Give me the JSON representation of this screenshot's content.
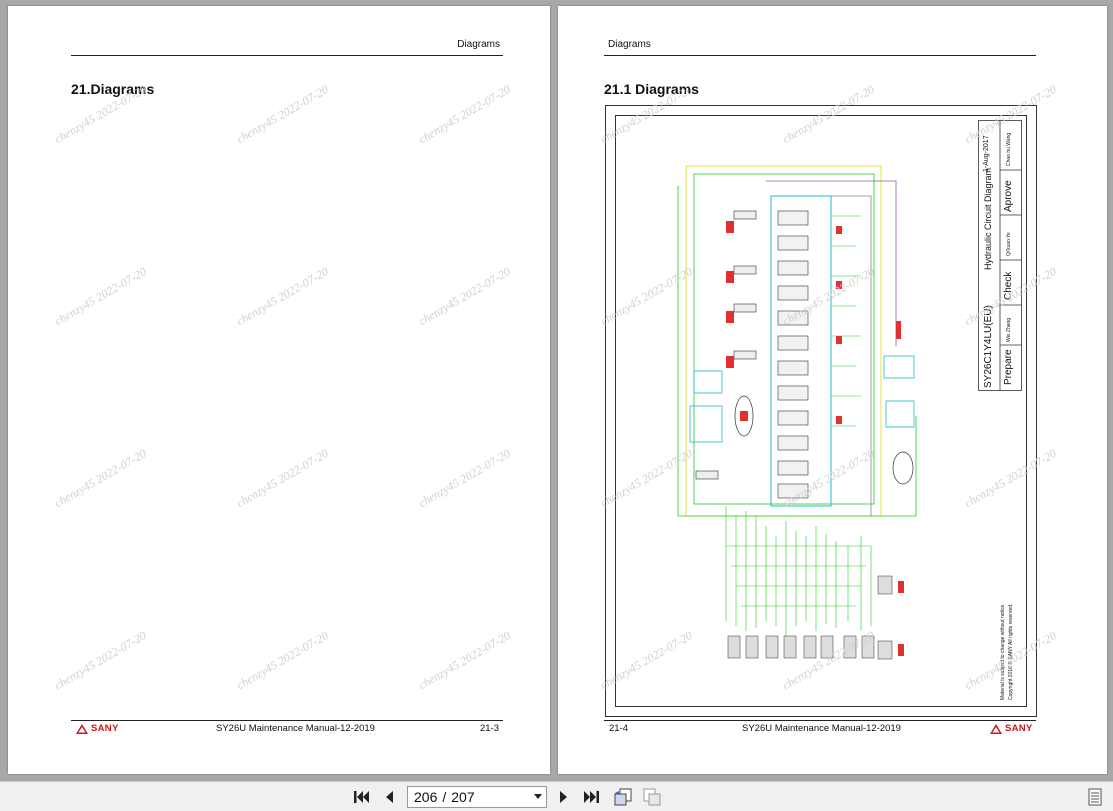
{
  "left_page": {
    "header": "Diagrams",
    "title": "21.Diagrams",
    "footer_brand": "SANY",
    "footer_manual": "SY26U Maintenance Manual-12-2019",
    "footer_page": "21-3"
  },
  "right_page": {
    "header": "Diagrams",
    "title": "21.1 Diagrams",
    "footer_page": "21-4",
    "footer_manual": "SY26U Maintenance Manual-12-2019",
    "footer_brand": "SANY",
    "title_block": {
      "model": "SY26C1Y4LU(EU)",
      "drawing": "Hydraulic Circuit Diagram",
      "date": "1-Aug-2017",
      "prepare": "Prepare",
      "check": "Check",
      "approve": "Aprove",
      "prepare_by": "Wei Zhang",
      "check_by": "Qi'kuan Ye",
      "approve_by": "Chao hu Wang",
      "notice": "Material is subject to change without notice.",
      "copyright": "Copyright 2016 © SANY All rights reserved."
    }
  },
  "watermark": "chenzy45 2022-07-20",
  "toolbar": {
    "current_page": "206",
    "separator": "/",
    "total_pages": "207"
  },
  "colors": {
    "logo_red": "#d0161c",
    "line_green": "#22cc22",
    "line_yellow": "#e0e000",
    "line_cyan": "#20b8d8",
    "line_purple": "#9a5ab0",
    "line_red": "#e03030"
  }
}
